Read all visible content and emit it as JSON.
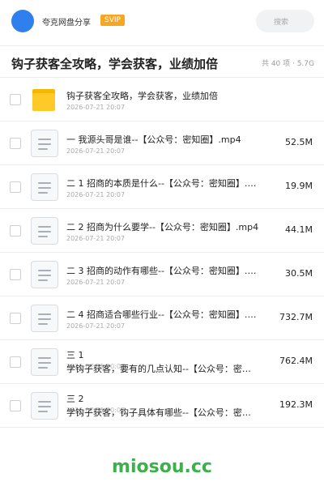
{
  "header": {
    "brand": "夸克网盘分享",
    "badge": "SVIP",
    "search_placeholder": "搜索"
  },
  "share": {
    "title": "钩子获客全攻略，学会获客，业绩加倍",
    "summary": "共 40 项 · 5.7G"
  },
  "items": [
    {
      "type": "folder",
      "name": "钩子获客全攻略，学会获客，业绩加倍",
      "date": "2026-07-21 20:07",
      "size": ""
    },
    {
      "type": "file",
      "name": "一 我源头哥是谁--【公众号：密知圈】.mp4",
      "date": "2026-07-21 20:07",
      "size": "52.5M"
    },
    {
      "type": "file",
      "name": "二 1 招商的本质是什么--【公众号：密知圈】.m…",
      "date": "2026-07-21 20:07",
      "size": "19.9M"
    },
    {
      "type": "file",
      "name": "二 2 招商为什么要学--【公众号：密知圈】.mp4",
      "date": "2026-07-21 20:07",
      "size": "44.1M"
    },
    {
      "type": "file",
      "name": "二 3 招商的动作有哪些--【公众号：密知圈】.m…",
      "date": "2026-07-21 20:07",
      "size": "30.5M"
    },
    {
      "type": "file",
      "name": "二 4 招商适合哪些行业--【公众号：密知圈】.m…",
      "date": "2026-07-21 20:07",
      "size": "732.7M"
    },
    {
      "type": "file",
      "name": "三 1",
      "name2": "学钩子获客，要有的几点认知--【公众号：密…",
      "date": "2026-07-21 20:07",
      "size": "762.4M"
    },
    {
      "type": "file",
      "name": "三 2",
      "name2": "学钩子获客，钩子具体有哪些--【公众号：密…",
      "date": "2026-07-21 20:07",
      "size": "192.3M"
    }
  ],
  "watermark": "miosou.cc",
  "colors": {
    "avatar": "#2f80ed",
    "badge": "#f5a623",
    "folder": "#ffc928",
    "watermark": "#3cb04a"
  }
}
